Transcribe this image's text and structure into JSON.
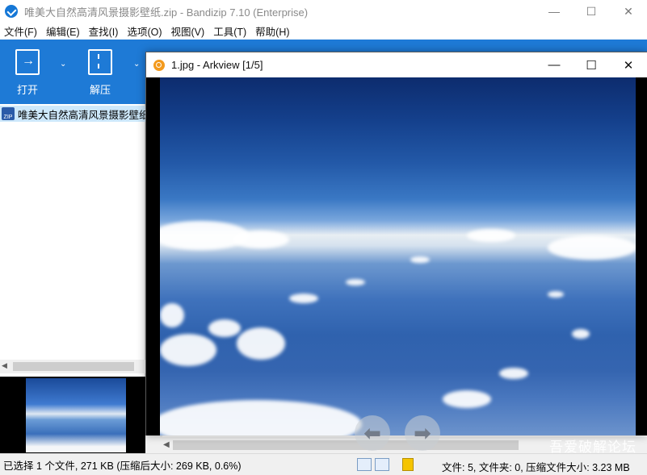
{
  "window": {
    "title": "唯美大自然高清风景摄影壁纸.zip - Bandizip 7.10 (Enterprise)",
    "minimize": "—",
    "maximize": "☐",
    "close": "✕"
  },
  "menu": [
    "文件(F)",
    "编辑(E)",
    "查找(I)",
    "选项(O)",
    "视图(V)",
    "工具(T)",
    "帮助(H)"
  ],
  "toolbar": {
    "open_label": "打开",
    "extract_label": "解压",
    "dropdown": "⌄"
  },
  "tree": {
    "archive_name": "唯美大自然高清风景摄影壁纸.zip",
    "zip_badge": "ZIP"
  },
  "arkview": {
    "title": "1.jpg - Arkview [1/5]",
    "minimize": "—",
    "maximize": "☐",
    "close": "✕",
    "prev_icon": "⬅",
    "next_icon": "➡"
  },
  "status": {
    "left": "已选择 1 个文件, 271 KB (压缩后大小: 269 KB, 0.6%)",
    "right": "文件: 5, 文件夹: 0, 压缩文件大小: 3.23 MB"
  },
  "watermark": "吾爱破解论坛"
}
